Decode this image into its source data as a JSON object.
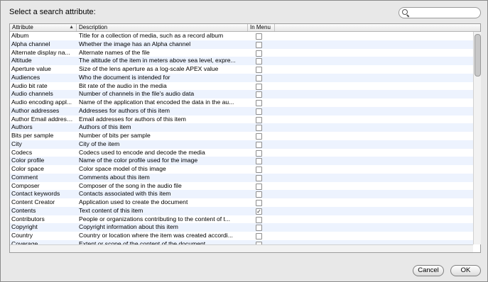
{
  "dialog": {
    "prompt": "Select a search attribute:",
    "search": {
      "value": "",
      "placeholder": ""
    }
  },
  "table": {
    "columns": [
      "Attribute",
      "Description",
      "In Menu"
    ],
    "sort_column": "Attribute",
    "rows": [
      {
        "attribute": "Album",
        "description": "Title for a collection of media, such as a record album",
        "in_menu": false
      },
      {
        "attribute": "Alpha channel",
        "description": "Whether the image has an Alpha channel",
        "in_menu": false
      },
      {
        "attribute": "Alternate display na...",
        "description": "Alternate names of the file",
        "in_menu": false
      },
      {
        "attribute": "Altitude",
        "description": "The altitude of the item in meters above sea level, expre...",
        "in_menu": false
      },
      {
        "attribute": "Aperture value",
        "description": "Size of the lens aperture as a log-scale APEX value",
        "in_menu": false
      },
      {
        "attribute": "Audiences",
        "description": "Who the document is intended for",
        "in_menu": false
      },
      {
        "attribute": "Audio bit rate",
        "description": "Bit rate of the audio in the media",
        "in_menu": false
      },
      {
        "attribute": "Audio channels",
        "description": "Number of channels in the file's audio data",
        "in_menu": false
      },
      {
        "attribute": "Audio encoding appl...",
        "description": "Name of the application that encoded the data in the au...",
        "in_menu": false
      },
      {
        "attribute": "Author addresses",
        "description": "Addresses for authors of this item",
        "in_menu": false
      },
      {
        "attribute": "Author Email addresses",
        "description": "Email addresses for authors of this item",
        "in_menu": false
      },
      {
        "attribute": "Authors",
        "description": "Authors of this item",
        "in_menu": false
      },
      {
        "attribute": "Bits per sample",
        "description": "Number of bits per sample",
        "in_menu": false
      },
      {
        "attribute": "City",
        "description": "City of the item",
        "in_menu": false
      },
      {
        "attribute": "Codecs",
        "description": "Codecs used to encode and decode the media",
        "in_menu": false
      },
      {
        "attribute": "Color profile",
        "description": "Name of the color profile used for the image",
        "in_menu": false
      },
      {
        "attribute": "Color space",
        "description": "Color space model of this image",
        "in_menu": false
      },
      {
        "attribute": "Comment",
        "description": "Comments about this item",
        "in_menu": false
      },
      {
        "attribute": "Composer",
        "description": "Composer of the song in the audio file",
        "in_menu": false
      },
      {
        "attribute": "Contact keywords",
        "description": "Contacts associated with this item",
        "in_menu": false
      },
      {
        "attribute": "Content Creator",
        "description": "Application used to create the document",
        "in_menu": false
      },
      {
        "attribute": "Contents",
        "description": "Text content of this item",
        "in_menu": true
      },
      {
        "attribute": "Contributors",
        "description": "People or organizations contributing to the content of t...",
        "in_menu": false
      },
      {
        "attribute": "Copyright",
        "description": "Copyright information about this item",
        "in_menu": false
      },
      {
        "attribute": "Country",
        "description": "Country or location where the item was created accordi...",
        "in_menu": false
      },
      {
        "attribute": "Coverage",
        "description": "Extent or scope of the content of the document",
        "in_menu": false
      }
    ]
  },
  "buttons": {
    "cancel": "Cancel",
    "ok": "OK"
  },
  "colors": {
    "alt_row": "#edf3fe",
    "background": "#e8e8e8"
  },
  "icons": {
    "search": "magnifier-icon",
    "sort": "sort-ascending-icon"
  }
}
